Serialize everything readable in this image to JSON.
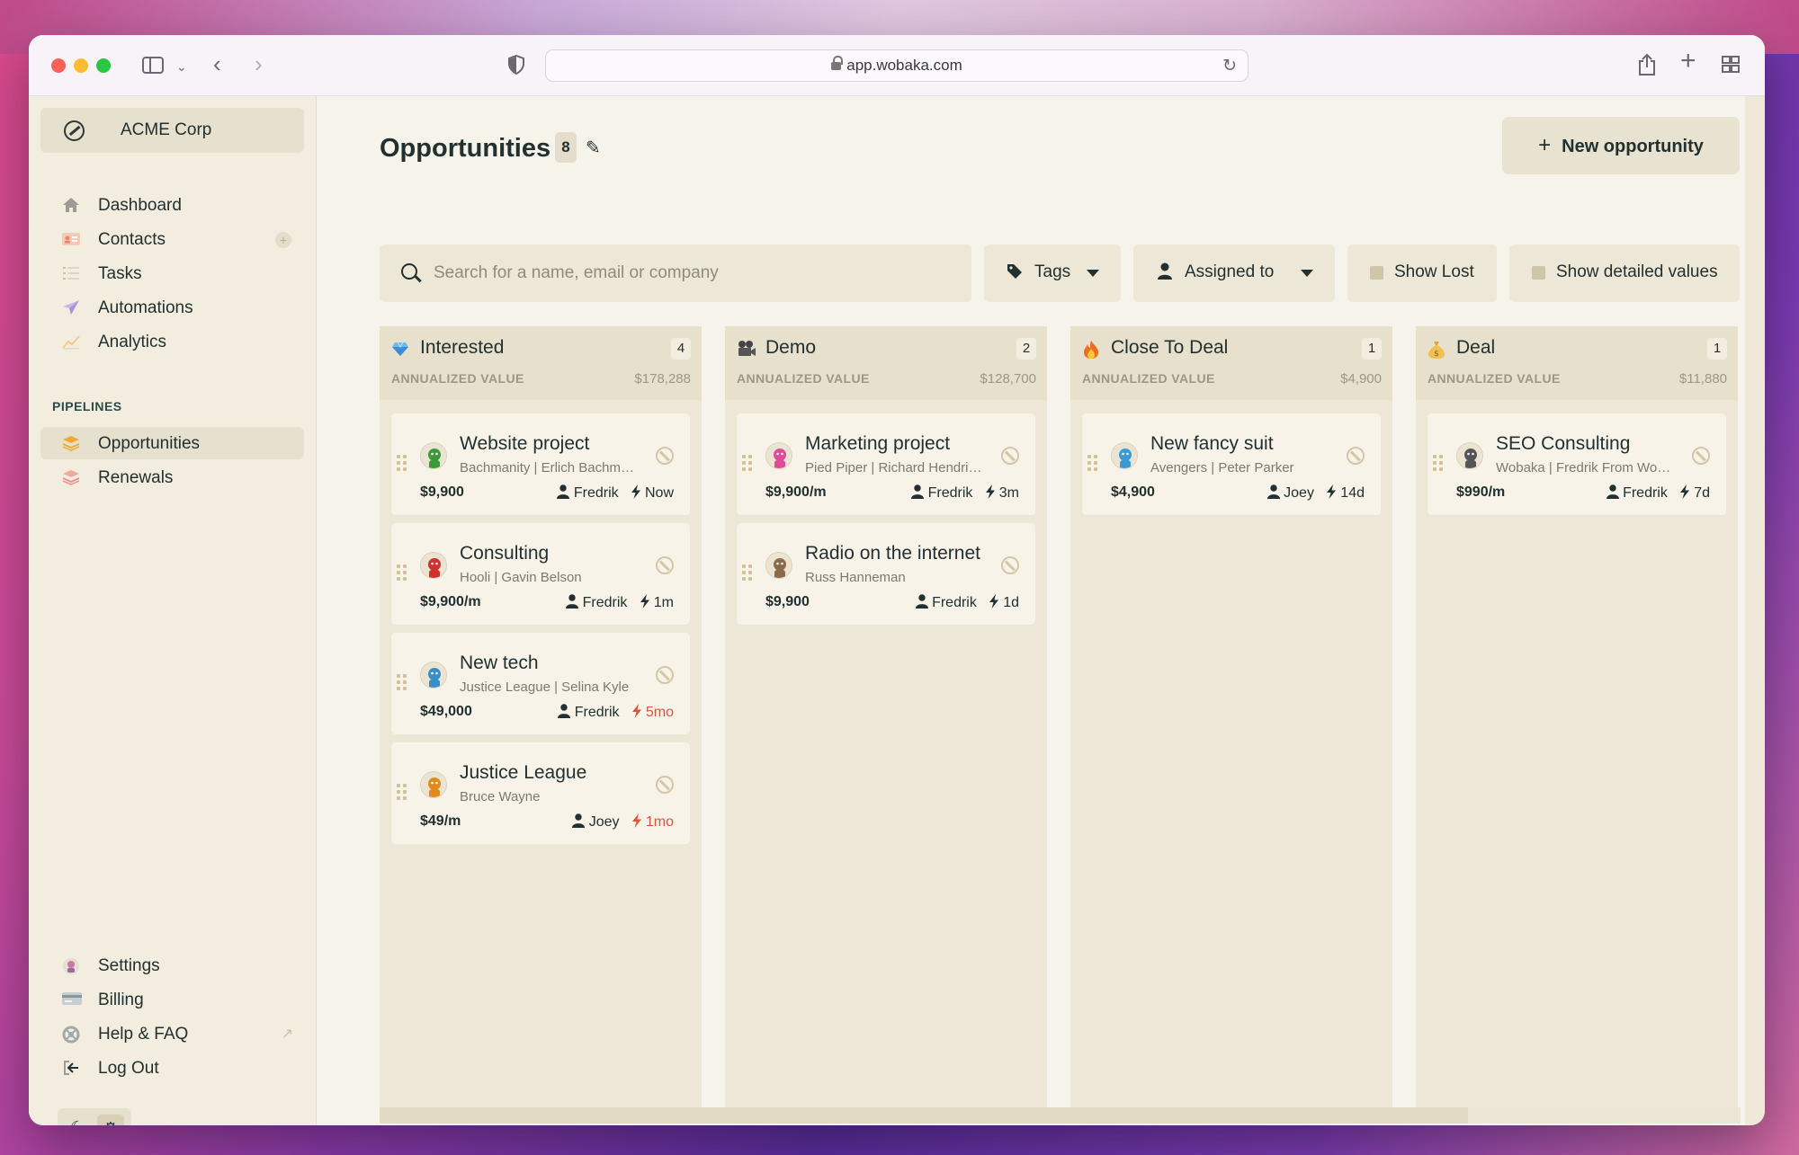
{
  "browser": {
    "url": "app.wobaka.com"
  },
  "sidebar": {
    "org_name": "ACME Corp",
    "nav": [
      {
        "label": "Dashboard",
        "icon": "home-icon"
      },
      {
        "label": "Contacts",
        "icon": "contact-card-icon"
      },
      {
        "label": "Tasks",
        "icon": "checklist-icon"
      },
      {
        "label": "Automations",
        "icon": "paper-plane-icon"
      },
      {
        "label": "Analytics",
        "icon": "chart-line-icon"
      }
    ],
    "pipelines_title": "PIPELINES",
    "pipelines": [
      {
        "label": "Opportunities",
        "icon": "layers-icon",
        "active": true
      },
      {
        "label": "Renewals",
        "icon": "layers-icon",
        "active": false
      }
    ],
    "bottom": [
      {
        "label": "Settings",
        "icon": "settings-avatar-icon"
      },
      {
        "label": "Billing",
        "icon": "credit-card-icon"
      },
      {
        "label": "Help & FAQ",
        "icon": "help-icon"
      },
      {
        "label": "Log Out",
        "icon": "logout-icon"
      }
    ]
  },
  "main": {
    "title": "Opportunities",
    "count": "8",
    "new_button": "New opportunity",
    "search_placeholder": "Search for a name, email or company",
    "filters": {
      "tags": "Tags",
      "assigned": "Assigned to",
      "show_lost": "Show Lost",
      "show_detailed": "Show detailed values"
    }
  },
  "board": {
    "annualized_label": "ANNUALIZED VALUE",
    "columns": [
      {
        "title": "Interested",
        "emoji": "gem-icon",
        "count": "4",
        "value": "$178,288",
        "cards": [
          {
            "title": "Website project",
            "sub": "Bachmanity | Erlich Bachmann",
            "value": "$9,900",
            "owner": "Fredrik",
            "time": "Now",
            "overdue": false,
            "avatar_color": "#3a9a3a"
          },
          {
            "title": "Consulting",
            "sub": "Hooli | Gavin Belson",
            "value": "$9,900/m",
            "owner": "Fredrik",
            "time": "1m",
            "overdue": false,
            "avatar_color": "#d03030"
          },
          {
            "title": "New tech",
            "sub": "Justice League | Selina Kyle",
            "value": "$49,000",
            "owner": "Fredrik",
            "time": "5mo",
            "overdue": true,
            "avatar_color": "#3a8ec8"
          },
          {
            "title": "Justice League",
            "sub": "Bruce Wayne",
            "value": "$49/m",
            "owner": "Joey",
            "time": "1mo",
            "overdue": true,
            "avatar_color": "#e08a20"
          }
        ]
      },
      {
        "title": "Demo",
        "emoji": "camera-icon",
        "count": "2",
        "value": "$128,700",
        "cards": [
          {
            "title": "Marketing project",
            "sub": "Pied Piper | Richard Hendricks",
            "value": "$9,900/m",
            "owner": "Fredrik",
            "time": "3m",
            "overdue": false,
            "avatar_color": "#e04a9a"
          },
          {
            "title": "Radio on the internet",
            "sub": "Russ Hanneman",
            "value": "$9,900",
            "owner": "Fredrik",
            "time": "1d",
            "overdue": false,
            "avatar_color": "#8a6a4a"
          }
        ]
      },
      {
        "title": "Close To Deal",
        "emoji": "fire-icon",
        "count": "1",
        "value": "$4,900",
        "cards": [
          {
            "title": "New fancy suit",
            "sub": "Avengers | Peter Parker",
            "value": "$4,900",
            "owner": "Joey",
            "time": "14d",
            "overdue": false,
            "avatar_color": "#3a9ad8"
          }
        ]
      },
      {
        "title": "Deal",
        "emoji": "money-bag-icon",
        "count": "1",
        "value": "$11,880",
        "cards": [
          {
            "title": "SEO Consulting",
            "sub": "Wobaka | Fredrik From Wobaka",
            "value": "$990/m",
            "owner": "Fredrik",
            "time": "7d",
            "overdue": false,
            "avatar_color": "#555555"
          }
        ]
      }
    ]
  },
  "colors": {
    "accent": "#22302f",
    "overdue": "#e0533a",
    "background": "#f6f3ea",
    "sidebar": "#f2eddf"
  }
}
